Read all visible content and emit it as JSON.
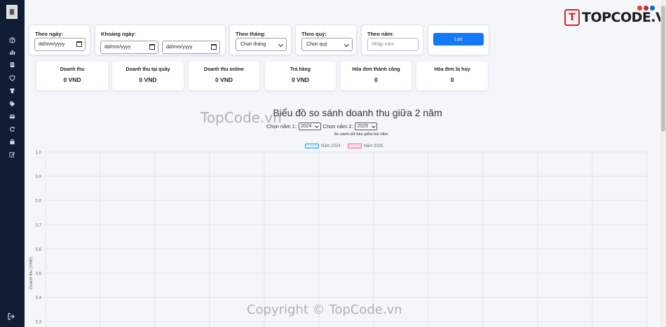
{
  "brand": {
    "mark": "T",
    "name": "TOPCODE.VN",
    "dot_colors": [
      "#e53935",
      "#c62828",
      "#1565c0"
    ]
  },
  "sidebar": {
    "icons": [
      "question-icon",
      "chart-bar-icon",
      "receipt-icon",
      "shield-icon",
      "shirt-icon",
      "tag-icon",
      "card-icon",
      "refresh-icon",
      "bag-icon",
      "edit-icon"
    ],
    "bottom_icon": "logout-icon"
  },
  "filters": {
    "by_day": {
      "label": "Theo ngày:",
      "value": "dd/mm/yyyy"
    },
    "date_range": {
      "label": "Khoảng ngày:",
      "from": "dd/mm/yyyy",
      "to": "dd/mm/yyyy"
    },
    "by_month": {
      "label": "Theo tháng:",
      "selected": "Chọn tháng"
    },
    "by_quarter": {
      "label": "Theo quý:",
      "selected": "Chọn quý"
    },
    "by_year": {
      "label": "Theo năm:",
      "placeholder": "Nhập năm"
    },
    "submit_label": "Lọc"
  },
  "stats": [
    {
      "title": "Doanh thu",
      "value": "0 VND"
    },
    {
      "title": "Doanh thu tại quầy",
      "value": "0 VND"
    },
    {
      "title": "Doanh thu online",
      "value": "0 VND"
    },
    {
      "title": "Trả hàng",
      "value": "0 VND"
    },
    {
      "title": "Hóa đơn thành công",
      "value": "0"
    },
    {
      "title": "Hóa đơn bị hủy",
      "value": "0"
    }
  ],
  "compare": {
    "title": "Biểu đồ so sánh doanh thu giữa 2 năm",
    "year1_label": "Chọn năm 1:",
    "year1_value": "2024",
    "year2_label": "Chọn năm 2:",
    "year2_value": "2025"
  },
  "chart_data": {
    "type": "line",
    "title": "So sánh dữ liệu giữa hai năm",
    "ylabel": "Doanh thu (VNĐ)",
    "ylim": [
      0,
      1.0
    ],
    "yticks": [
      "1,0",
      "0,9",
      "0,8",
      "0,7",
      "0,6",
      "0,5",
      "0,4",
      "0,3"
    ],
    "grid": true,
    "legend_position": "top-center",
    "series": [
      {
        "name": "Năm 2024",
        "color": "#36a2eb",
        "fill": "#d7ecfb",
        "values": []
      },
      {
        "name": "Năm 2025",
        "color": "#ff6384",
        "fill": "#ffe0e6",
        "values": []
      }
    ]
  },
  "watermarks": {
    "top": "TopCode.vn",
    "bottom": "Copyright © TopCode.vn"
  }
}
